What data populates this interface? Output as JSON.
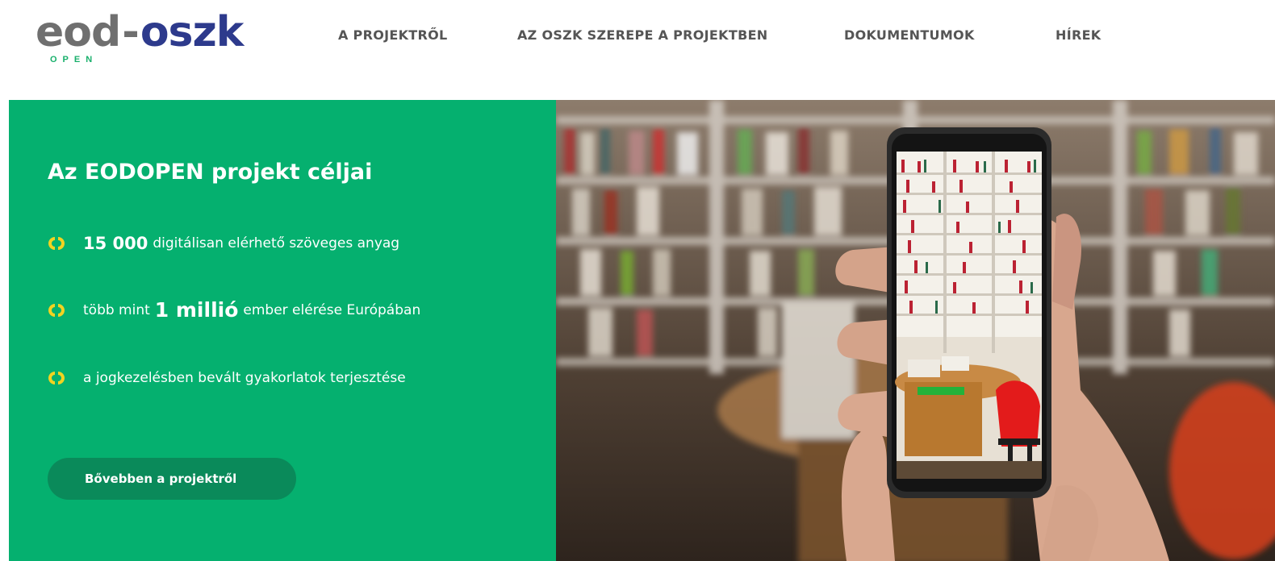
{
  "logo": {
    "main_left": "eod",
    "dash": "-",
    "main_right": "oszk",
    "sub": "OPEN"
  },
  "nav": {
    "items": [
      {
        "label": "A PROJEKTRŐL"
      },
      {
        "label": "AZ OSZK SZEREPE A PROJEKTBEN"
      },
      {
        "label": "DOKUMENTUMOK"
      },
      {
        "label": "HÍREK"
      }
    ]
  },
  "hero": {
    "title": "Az EODOPEN projekt céljai",
    "bullets": [
      {
        "strong": "15 000",
        "text": "digitálisan elérhető szöveges anyag"
      },
      {
        "pre": "több mint",
        "strong": "1 millió",
        "text": "ember elérése Európában"
      },
      {
        "text": "a jogkezelésben bevált gyakorlatok terjesztése"
      }
    ],
    "button_label": "Bővebben a projektről",
    "bullet_icon": "eod-logo-mark-icon"
  },
  "colors": {
    "green": "#05b06f",
    "button": "#0a8a5a",
    "logo_grey": "#6f6f6f",
    "logo_blue": "#2d3a8c",
    "bullet_yellow": "#f2d321"
  },
  "photo": {
    "icon": "library-phone-photo"
  }
}
